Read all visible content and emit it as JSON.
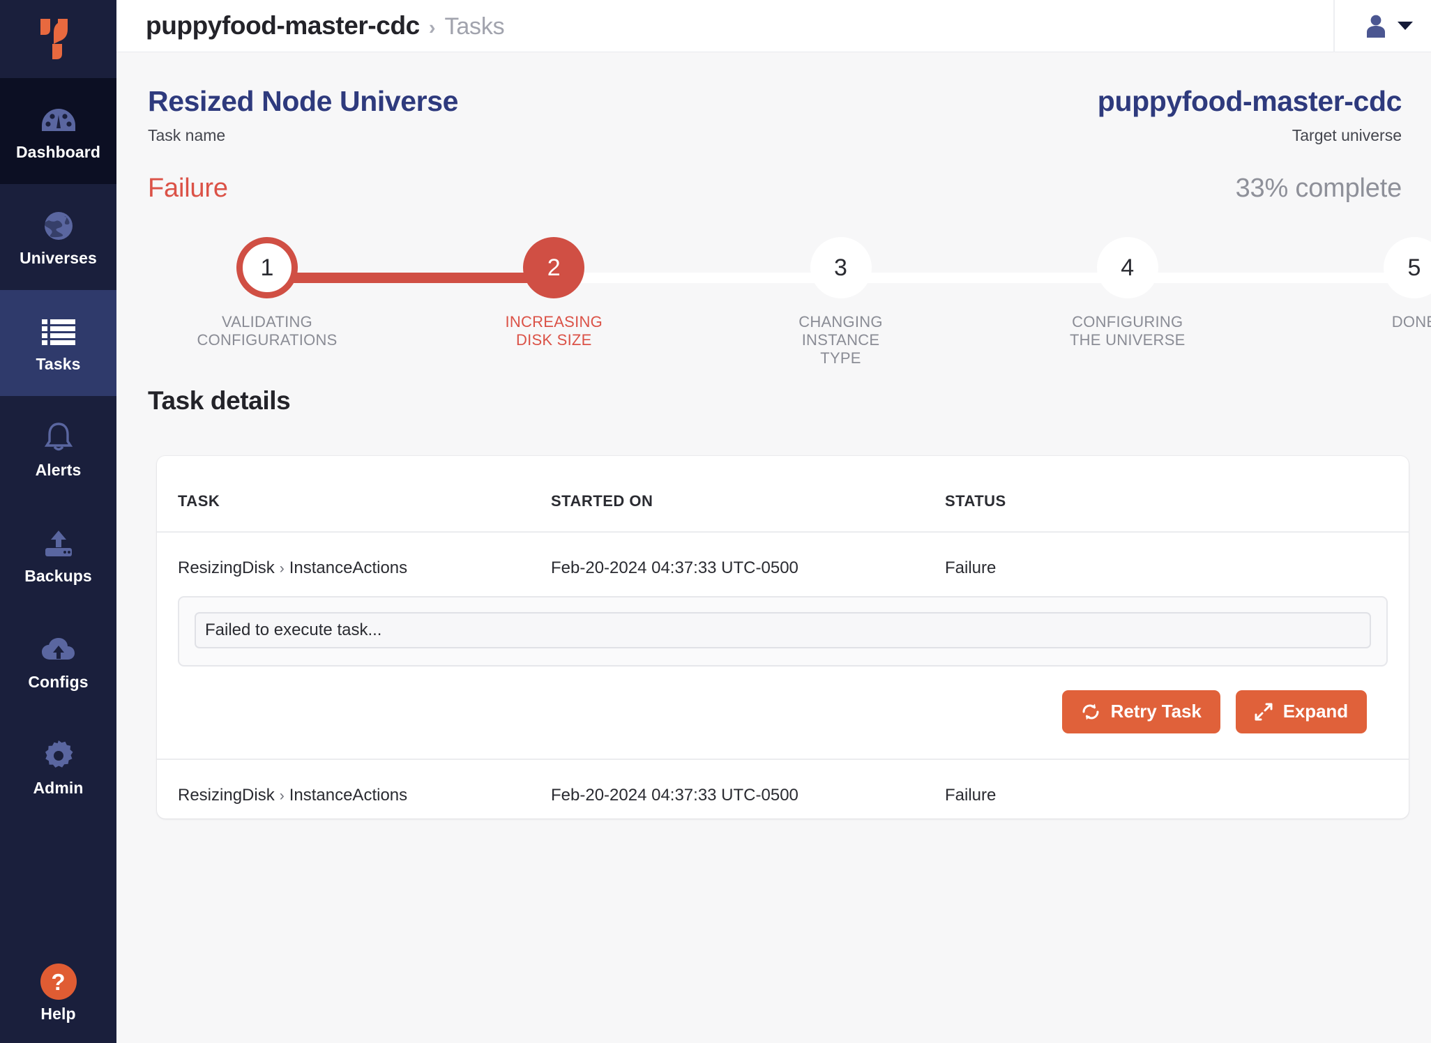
{
  "sidebar": {
    "logo_name": "yugabyte-logo",
    "items": [
      {
        "label": "Dashboard",
        "icon": "gauge-icon",
        "state": "hovered"
      },
      {
        "label": "Universes",
        "icon": "globe-icon",
        "state": "default"
      },
      {
        "label": "Tasks",
        "icon": "list-icon",
        "state": "active"
      },
      {
        "label": "Alerts",
        "icon": "bell-icon",
        "state": "default"
      },
      {
        "label": "Backups",
        "icon": "backup-upload-icon",
        "state": "default"
      },
      {
        "label": "Configs",
        "icon": "cloud-upload-icon",
        "state": "default"
      },
      {
        "label": "Admin",
        "icon": "gear-icon",
        "state": "default"
      }
    ],
    "help": {
      "label": "Help",
      "glyph": "?"
    }
  },
  "header": {
    "breadcrumb_current": "puppyfood-master-cdc",
    "breadcrumb_separator": "›",
    "breadcrumb_parent": "Tasks",
    "user_icon": "user-avatar-icon",
    "caret_icon": "chevron-down-icon"
  },
  "summary": {
    "task_name": "Resized Node Universe",
    "task_name_label": "Task name",
    "status": "Failure",
    "target_universe": "puppyfood-master-cdc",
    "target_universe_label": "Target universe",
    "progress": "33% complete"
  },
  "stepper": {
    "steps": [
      {
        "number": "1",
        "label": "VALIDATING\nCONFIGURATIONS",
        "state": "done"
      },
      {
        "number": "2",
        "label": "INCREASING\nDISK SIZE",
        "state": "current"
      },
      {
        "number": "3",
        "label": "CHANGING\nINSTANCE TYPE",
        "state": "pending"
      },
      {
        "number": "4",
        "label": "CONFIGURING\nTHE UNIVERSE",
        "state": "pending"
      },
      {
        "number": "5",
        "label": "DONE",
        "state": "pending"
      }
    ]
  },
  "details": {
    "heading": "Task details",
    "columns": {
      "task": "TASK",
      "started_on": "STARTED ON",
      "status": "STATUS"
    },
    "rows": [
      {
        "task_parent": "ResizingDisk",
        "task_separator": "›",
        "task_child": "InstanceActions",
        "started_on": "Feb-20-2024 04:37:33 UTC-0500",
        "status": "Failure",
        "error": "Failed to execute task...",
        "retry_label": "Retry Task",
        "retry_icon": "refresh-icon",
        "expand_label": "Expand",
        "expand_icon": "expand-arrows-icon"
      },
      {
        "task_parent": "ResizingDisk",
        "task_separator": "›",
        "task_child": "InstanceActions",
        "started_on": "Feb-20-2024 04:37:33 UTC-0500",
        "status": "Failure"
      }
    ]
  },
  "colors": {
    "sidebar_bg": "#1A1F3C",
    "sidebar_active": "#2F3A6B",
    "brand_orange": "#E0613A",
    "failure_red": "#DB5247",
    "step_red": "#D04F44",
    "title_navy": "#2E3A7D",
    "page_bg": "#F7F7F8"
  }
}
